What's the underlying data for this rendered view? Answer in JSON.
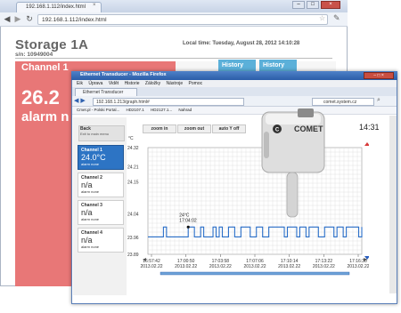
{
  "back_browser": {
    "tab_title": "192.168.1.112/index.html",
    "tab_close": "×",
    "url": "192.168.1.112/index.html",
    "controls": {
      "minimize": "–",
      "maximize": "□",
      "close": "×"
    }
  },
  "device": {
    "name": "Storage 1A",
    "serial": "s/n: 10949004",
    "local_time": "Local time: Tuesday, August 28, 2012 14:10:28"
  },
  "back_channel": {
    "name": "Channel 1",
    "value": "26.2",
    "alarm": "alarm n"
  },
  "history_buttons": [
    "History",
    "History"
  ],
  "front_browser": {
    "title": "Ethernet Transducer - Mozilla Firefox",
    "menu": [
      "Eik",
      "Úprava",
      "Vidět",
      "Historie",
      "Záložky",
      "Nástroje",
      "Pomoc"
    ],
    "tab_title": "Ethernet Transducer",
    "url": "192.168.1.213/graph.html#",
    "search_text": "comet.system.cz",
    "bookmarks": [
      "Cmet.pl - Polski Portal...",
      "HD2107.1",
      "HD2127.1...",
      "Nahrad"
    ]
  },
  "panel": {
    "back_label": "Back",
    "back_sub": "Exit to main menu",
    "channels": [
      {
        "name": "Channel 1",
        "value": "24.0°C",
        "alarm": "alarm none"
      },
      {
        "name": "Channel 2",
        "value": "n/a",
        "alarm": "alarm none"
      },
      {
        "name": "Channel 3",
        "value": "n/a",
        "alarm": "alarm none"
      },
      {
        "name": "Channel 4",
        "value": "n/a",
        "alarm": "alarm none"
      }
    ]
  },
  "toolbar": {
    "zoom_in": "zoom in",
    "zoom_out": "zoom out",
    "auto_y": "auto Y off"
  },
  "front_time": "14:31",
  "brand": "COMET",
  "colors": {
    "channel_card_red": "#e87777",
    "history_blue": "#5bb0d9",
    "selected_channel_blue": "#2d74c4",
    "series_blue": "#2a6fc9"
  },
  "chart_data": {
    "type": "line",
    "ylabel": "°C",
    "ylim": [
      23.89,
      24.32
    ],
    "yticks": [
      "24.32",
      "24.21",
      "24.15",
      "24.04",
      "23.96",
      "23.89"
    ],
    "xticks": [
      {
        "time": "16:57:42",
        "date": "2013.02.22"
      },
      {
        "time": "17:00:50",
        "date": "2013.02.22"
      },
      {
        "time": "17:03:58",
        "date": "2013.02.22"
      },
      {
        "time": "17:07:06",
        "date": "2013.02.22"
      },
      {
        "time": "17:10:14",
        "date": "2013.02.22"
      },
      {
        "time": "17:13:22",
        "date": "2013.02.22"
      },
      {
        "time": "17:16:30",
        "date": "2013.02.22"
      }
    ],
    "annotation": {
      "text": "24°C\n17:04:02",
      "value": 24.0
    },
    "series": [
      {
        "values": [
          23.96,
          23.96,
          23.96,
          23.96,
          23.96,
          24.0,
          23.96,
          23.96,
          23.96,
          23.96,
          23.96,
          23.96,
          23.96,
          24.0,
          24.0,
          23.96,
          23.96,
          24.0,
          23.96,
          23.96,
          23.96,
          24.0,
          23.96,
          24.0,
          23.96,
          23.96,
          24.0,
          24.0,
          23.96,
          23.96,
          24.0,
          24.0,
          24.0,
          23.96,
          23.96,
          24.0,
          24.0,
          23.96,
          23.96,
          24.0,
          24.0,
          24.0,
          24.0,
          24.0,
          23.96,
          24.0,
          24.0,
          24.0,
          23.96,
          24.0,
          24.0,
          23.96,
          24.0,
          24.0,
          24.0,
          23.96,
          23.96,
          24.0,
          24.0,
          24.0,
          23.96,
          24.0,
          24.0,
          23.96,
          24.0,
          24.0,
          24.0,
          24.0,
          23.96,
          24.0
        ]
      }
    ],
    "grid": true
  }
}
